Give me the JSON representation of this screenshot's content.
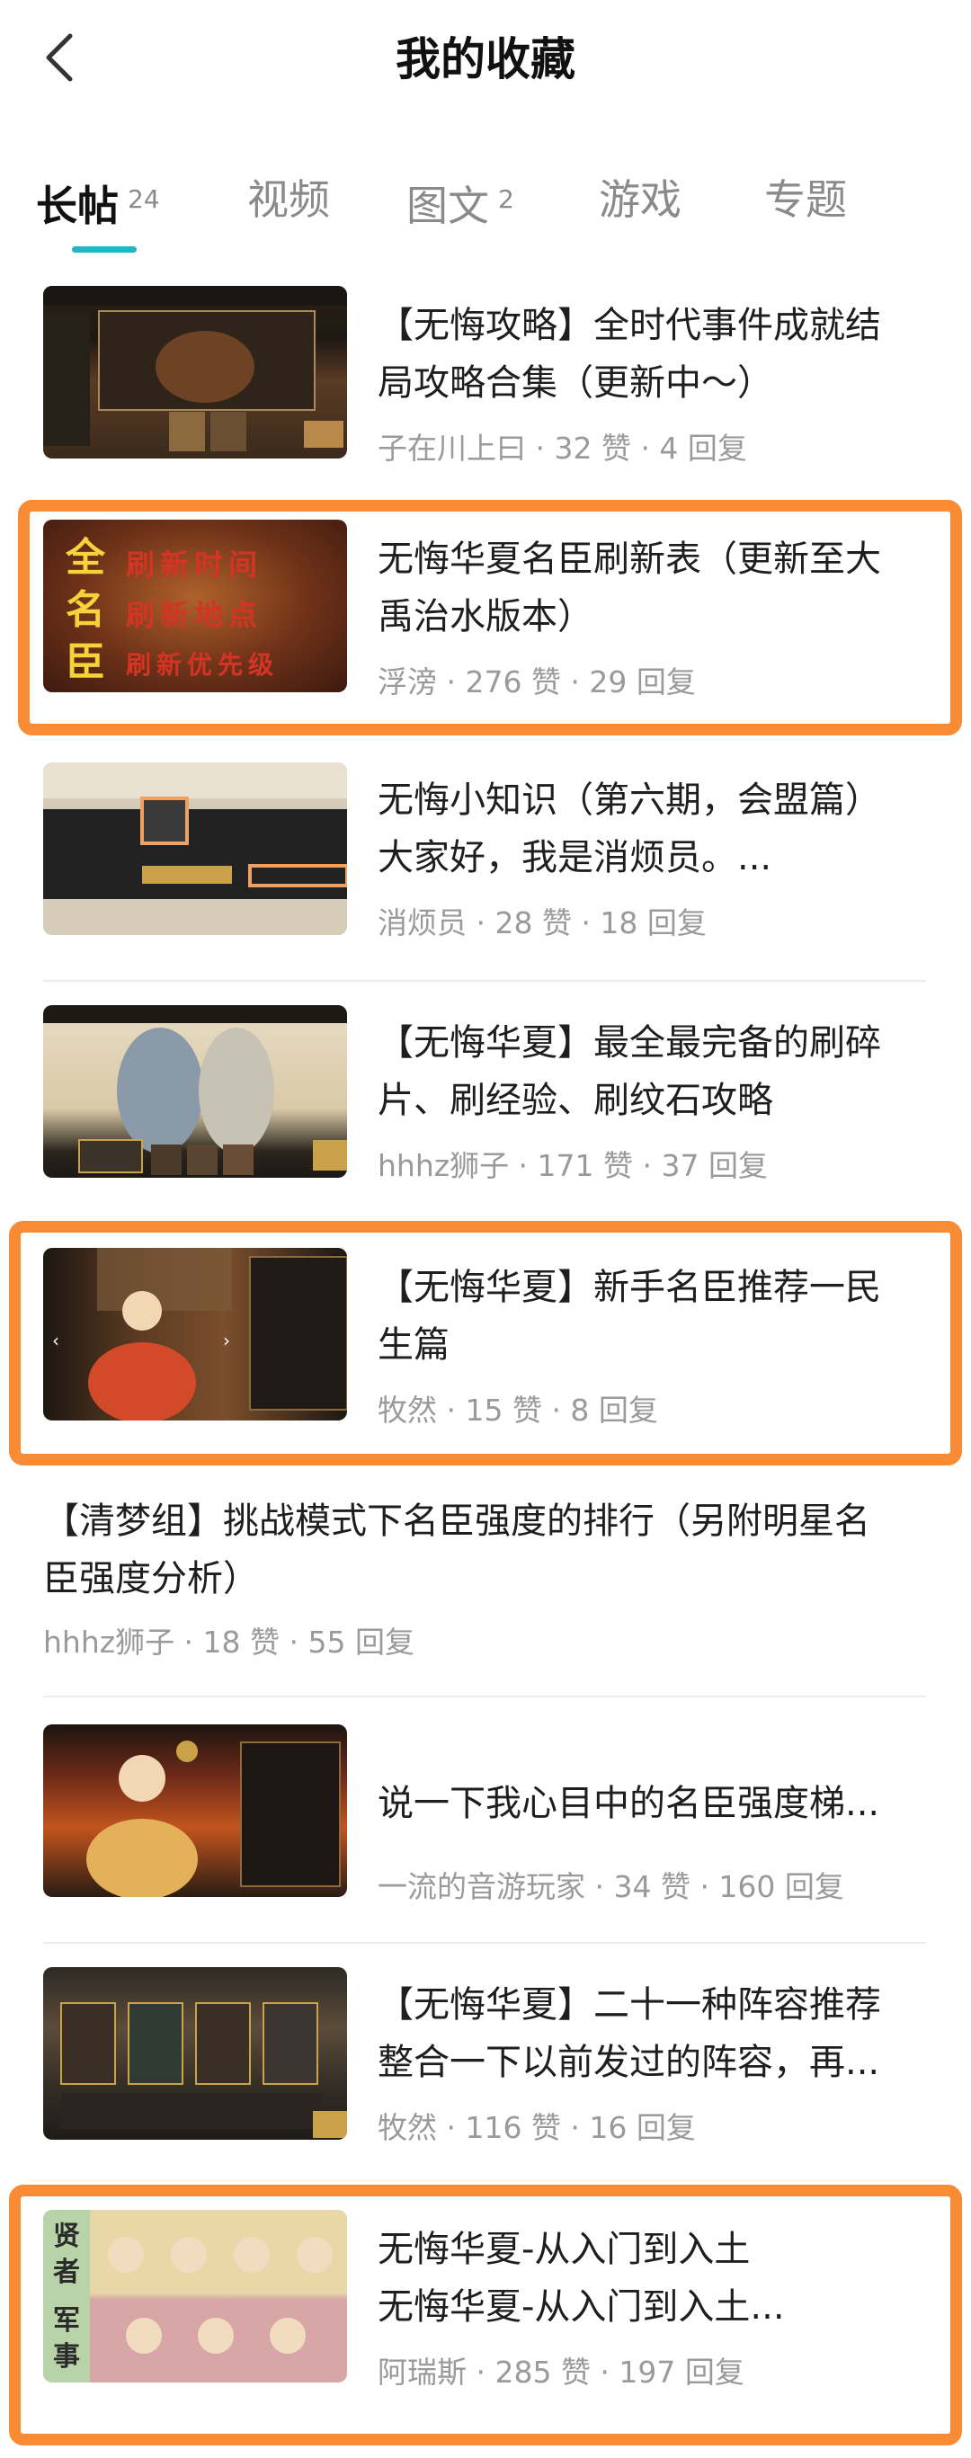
{
  "header": {
    "title": "我的收藏",
    "back_icon": "chevron-left-icon"
  },
  "tabs": [
    {
      "label": "长帖",
      "count": "24",
      "active": true
    },
    {
      "label": "视频",
      "count": ""
    },
    {
      "label": "图文",
      "count": "2"
    },
    {
      "label": "游戏",
      "count": ""
    },
    {
      "label": "专题",
      "count": ""
    }
  ],
  "accent_color": "#1fb6c8",
  "highlight_color": "#f98b34",
  "posts": [
    {
      "title_line1": "【无悔攻略】全时代事件成就结",
      "title_line2": "局攻略合集（更新中～）",
      "meta": "子在川上曰 · 32 赞 · 4 回复",
      "has_thumb": true
    },
    {
      "title_line1": "无悔华夏名臣刷新表（更新至大",
      "title_line2": "禹治水版本）",
      "meta": "浮滂 · 276 赞 · 29 回复",
      "has_thumb": true,
      "thumb_text": {
        "left": [
          "全",
          "名",
          "臣"
        ],
        "right": [
          "刷新时间",
          "刷新地点",
          "刷新优先级"
        ]
      }
    },
    {
      "title_line1": "无悔小知识（第六期，会盟篇）",
      "title_line2": "大家好，我是消烦员。...",
      "meta": "消烦员 · 28 赞 · 18 回复",
      "has_thumb": true
    },
    {
      "title_line1": "【无悔华夏】最全最完备的刷碎",
      "title_line2": "片、刷经验、刷纹石攻略",
      "meta": "hhhz狮子 · 171 赞 · 37 回复",
      "has_thumb": true
    },
    {
      "title_line1": "【无悔华夏】新手名臣推荐一民",
      "title_line2": "生篇",
      "meta": "牧然 · 15 赞 · 8 回复",
      "has_thumb": true
    },
    {
      "title_line1": "【清梦组】挑战模式下名臣强度的排行（另附明星名",
      "title_line2": "臣强度分析）",
      "meta": "hhhz狮子 · 18 赞 · 55 回复",
      "has_thumb": false
    },
    {
      "title_line1": "说一下我心目中的名臣强度梯...",
      "title_line2": "",
      "meta": "一流的音游玩家 · 34 赞 · 160 回复",
      "has_thumb": true
    },
    {
      "title_line1": "【无悔华夏】二十一种阵容推荐",
      "title_line2": "整合一下以前发过的阵容，再...",
      "meta": "牧然 · 116 赞 · 16 回复",
      "has_thumb": true
    },
    {
      "title_line1": "无悔华夏-从入门到入土",
      "title_line2": "无悔华夏-从入门到入土...",
      "meta": "阿瑞斯 · 285 赞 · 197 回复",
      "has_thumb": true,
      "thumb_text": {
        "left": [
          "贤",
          "者",
          "军",
          "事"
        ]
      }
    }
  ]
}
